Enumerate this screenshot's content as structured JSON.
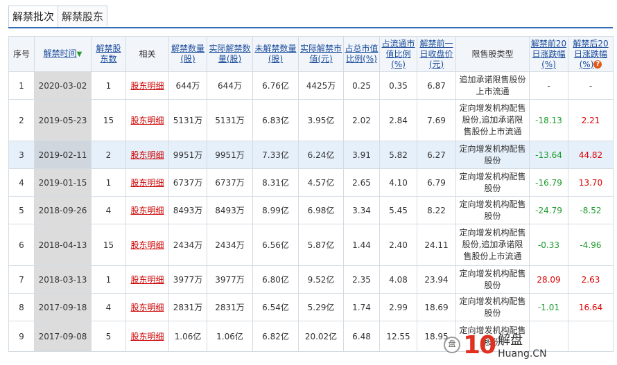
{
  "tabs": [
    "解禁批次",
    "解禁股东"
  ],
  "headers": {
    "seq": "序号",
    "date": "解禁时间",
    "date_sort_icon": "arrow-down-icon",
    "holders": "解禁股东数",
    "related": "相关",
    "qty": "解禁数量(股)",
    "actual_qty": "实际解禁数量(股)",
    "unlocked_qty": "未解禁数量(股)",
    "actual_value": "实际解禁市值(元)",
    "total_pct": "占总市值比例(%)",
    "float_pct": "占流通市值比例(%)",
    "prev_close": "解禁前一日收盘价(元)",
    "share_type": "限售股类型",
    "pre20": "解禁前20日涨跌幅(%)",
    "post20": "解禁后20日涨跌幅(%)",
    "help_icon": "question-icon"
  },
  "rows": [
    {
      "seq": "1",
      "date": "2020-03-02",
      "holders": "1",
      "link": "股东明细",
      "qty": "644万",
      "actual_qty": "644万",
      "unlocked_qty": "6.76亿",
      "actual_value": "4425万",
      "total_pct": "0.25",
      "float_pct": "0.35",
      "prev_close": "6.87",
      "share_type": "追加承诺限售股份上市流通",
      "pre20": "-",
      "pre20_color": "neutral",
      "post20": "-",
      "post20_color": "neutral"
    },
    {
      "seq": "2",
      "date": "2019-05-23",
      "holders": "15",
      "link": "股东明细",
      "qty": "5131万",
      "actual_qty": "5131万",
      "unlocked_qty": "6.83亿",
      "actual_value": "3.95亿",
      "total_pct": "2.02",
      "float_pct": "2.84",
      "prev_close": "7.69",
      "share_type": "定向增发机构配售股份,追加承诺限售股份上市流通",
      "pre20": "-18.13",
      "pre20_color": "green",
      "post20": "2.21",
      "post20_color": "red"
    },
    {
      "seq": "3",
      "date": "2019-02-11",
      "holders": "2",
      "link": "股东明细",
      "qty": "9951万",
      "actual_qty": "9951万",
      "unlocked_qty": "7.33亿",
      "actual_value": "6.24亿",
      "total_pct": "3.91",
      "float_pct": "5.82",
      "prev_close": "6.27",
      "share_type": "定向增发机构配售股份",
      "pre20": "-13.64",
      "pre20_color": "green",
      "post20": "44.82",
      "post20_color": "red"
    },
    {
      "seq": "4",
      "date": "2019-01-15",
      "holders": "1",
      "link": "股东明细",
      "qty": "6737万",
      "actual_qty": "6737万",
      "unlocked_qty": "8.31亿",
      "actual_value": "4.57亿",
      "total_pct": "2.65",
      "float_pct": "4.10",
      "prev_close": "6.79",
      "share_type": "定向增发机构配售股份",
      "pre20": "-16.79",
      "pre20_color": "green",
      "post20": "13.70",
      "post20_color": "red"
    },
    {
      "seq": "5",
      "date": "2018-09-26",
      "holders": "4",
      "link": "股东明细",
      "qty": "8493万",
      "actual_qty": "8493万",
      "unlocked_qty": "8.99亿",
      "actual_value": "6.98亿",
      "total_pct": "3.34",
      "float_pct": "5.45",
      "prev_close": "8.22",
      "share_type": "定向增发机构配售股份",
      "pre20": "-24.79",
      "pre20_color": "green",
      "post20": "-8.52",
      "post20_color": "green"
    },
    {
      "seq": "6",
      "date": "2018-04-13",
      "holders": "15",
      "link": "股东明细",
      "qty": "2434万",
      "actual_qty": "2434万",
      "unlocked_qty": "6.56亿",
      "actual_value": "5.87亿",
      "total_pct": "1.44",
      "float_pct": "2.40",
      "prev_close": "24.11",
      "share_type": "定向增发机构配售股份,追加承诺限售股份上市流通",
      "pre20": "-0.33",
      "pre20_color": "green",
      "post20": "-4.96",
      "post20_color": "green"
    },
    {
      "seq": "7",
      "date": "2018-03-13",
      "holders": "1",
      "link": "股东明细",
      "qty": "3977万",
      "actual_qty": "3977万",
      "unlocked_qty": "6.80亿",
      "actual_value": "9.52亿",
      "total_pct": "2.35",
      "float_pct": "4.08",
      "prev_close": "23.94",
      "share_type": "定向增发机构配售股份",
      "pre20": "28.09",
      "pre20_color": "red",
      "post20": "2.63",
      "post20_color": "red"
    },
    {
      "seq": "8",
      "date": "2017-09-18",
      "holders": "4",
      "link": "股东明细",
      "qty": "2831万",
      "actual_qty": "2831万",
      "unlocked_qty": "6.54亿",
      "actual_value": "5.29亿",
      "total_pct": "1.74",
      "float_pct": "2.99",
      "prev_close": "18.69",
      "share_type": "定向增发机构配售股份",
      "pre20": "-1.01",
      "pre20_color": "green",
      "post20": "16.64",
      "post20_color": "red"
    },
    {
      "seq": "9",
      "date": "2017-09-08",
      "holders": "5",
      "link": "股东明细",
      "qty": "1.06亿",
      "actual_qty": "1.06亿",
      "unlocked_qty": "6.82亿",
      "actual_value": "20.02亿",
      "total_pct": "6.48",
      "float_pct": "12.55",
      "prev_close": "18.95",
      "share_type": "定向增发机构配售股份",
      "pre20": "",
      "pre20_color": "neutral",
      "post20": "",
      "post20_color": "neutral"
    }
  ],
  "watermark": {
    "badge": "盘",
    "number": "10",
    "line1": "解盘",
    "line2": "Huang.CN"
  },
  "colors": {
    "accent": "#2f6db5",
    "up": "#dd0000",
    "down": "#1a9a2a",
    "link": "#cc0000",
    "header_bg": "#f2f6fb",
    "highlight_row": "#e6f0fa"
  }
}
